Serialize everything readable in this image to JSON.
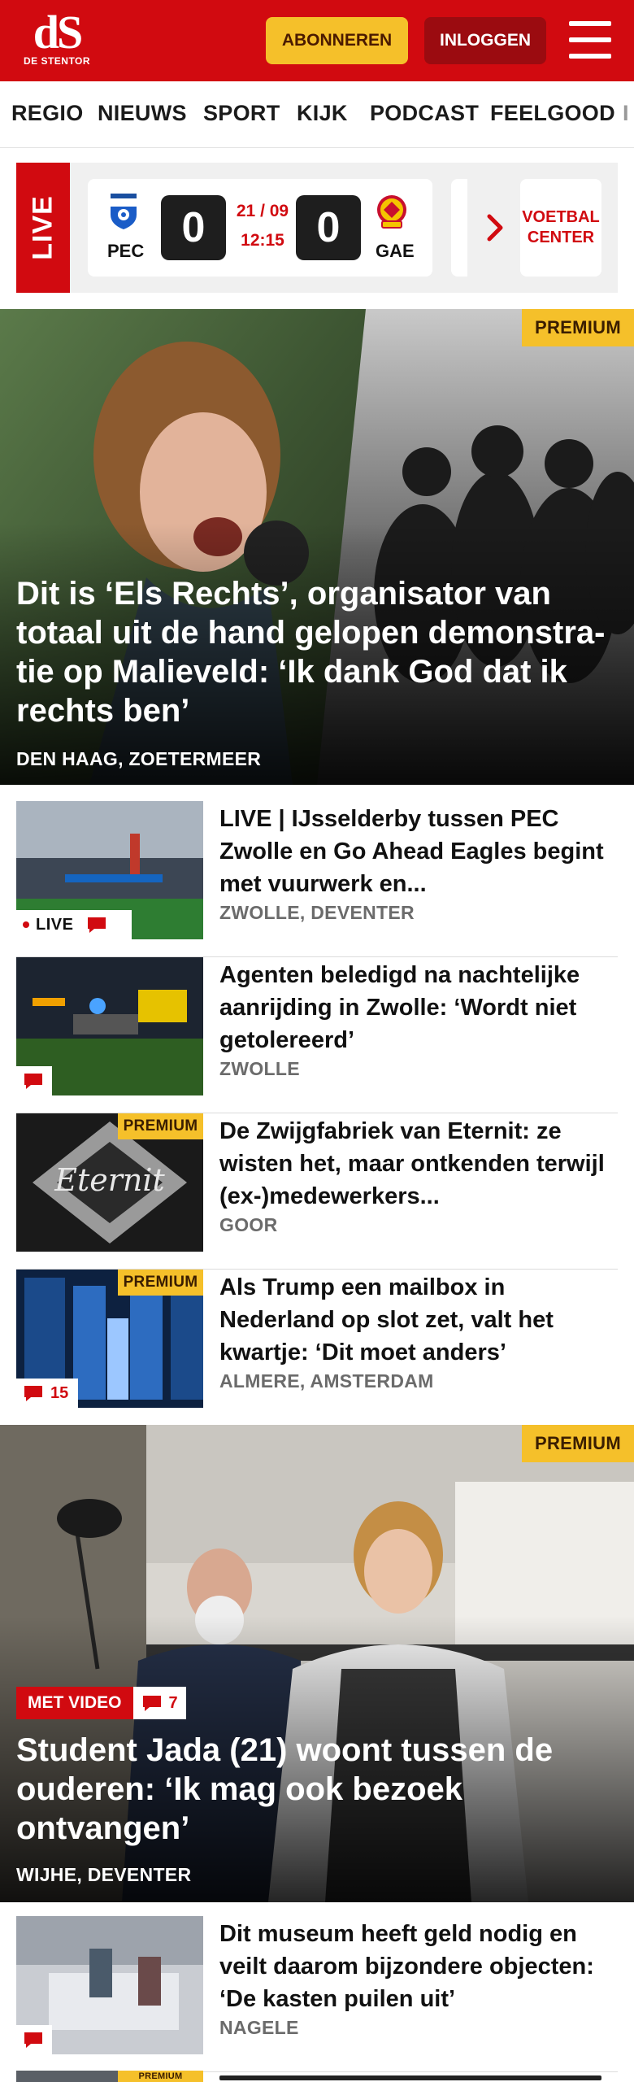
{
  "header": {
    "logo_mark": "dS",
    "logo_sub": "DE STENTOR",
    "subscribe_label": "ABONNEREN",
    "login_label": "INLOGGEN"
  },
  "nav": {
    "items": [
      "REGIO",
      "NIEUWS",
      "SPORT",
      "KIJK",
      "PODCAST",
      "FEELGOOD",
      "I"
    ]
  },
  "live": {
    "tag": "LIVE",
    "home_team": "PEC",
    "away_team": "GAE",
    "home_score": "0",
    "away_score": "0",
    "date": "21 / 09",
    "time": "12:15",
    "center_line1": "VOETBAL",
    "center_line2": "CENTER"
  },
  "hero": {
    "badge": "PREMIUM",
    "title": "Dit is ‘Els Rechts’, organisator van totaal uit de hand gelopen demonstra­tie op Malieveld: ‘Ik dank God dat ik rechts ben’",
    "location": "DEN HAAG, ZOETERMEER"
  },
  "articles": [
    {
      "title": "LIVE | IJsselderby tussen PEC Zwolle en Go Ahead Eagles begint met vuurwerk en...",
      "location": "ZWOLLE, DEVENTER",
      "live_label": "LIVE",
      "comments": ""
    },
    {
      "title": "Agenten beledigd na nachtelijke aanrijding in Zwolle: ‘Wordt niet getolereerd’",
      "location": "ZWOLLE",
      "comments": ""
    },
    {
      "title": "De Zwijgfabriek van Eternit: ze wisten het, maar ontkenden terwijl (ex-)medewerkers...",
      "location": "GOOR",
      "badge": "PREMIUM",
      "thumb_text": "Eternit"
    },
    {
      "title": "Als Trump een mailbox in Nederland op slot zet, valt het kwartje: ‘Dit moet anders’",
      "location": "ALMERE, AMSTERDAM",
      "badge": "PREMIUM",
      "comments": "15"
    }
  ],
  "hero2": {
    "badge": "PREMIUM",
    "video_label": "MET VIDEO",
    "comments": "7",
    "title": "Student Jada (21) woont tussen de ouderen: ‘Ik mag ook bezoek ontvangen’",
    "location": "WIJHE, DEVENTER"
  },
  "article_bottom": {
    "title": "Dit museum heeft geld nodig en veilt daarom bijzondere objecten: ‘De kasten puilen uit’",
    "location": "NAGELE"
  },
  "partial_article": {
    "badge": "PREMIUM"
  },
  "colors": {
    "brand_red": "#d10a10",
    "premium_yellow": "#f5c02a",
    "login_dark_red": "#9b0b10"
  },
  "icons": [
    "menu-icon",
    "chevron-right-icon",
    "comment-icon",
    "pec-zwolle-crest-icon",
    "go-ahead-eagles-crest-icon"
  ]
}
